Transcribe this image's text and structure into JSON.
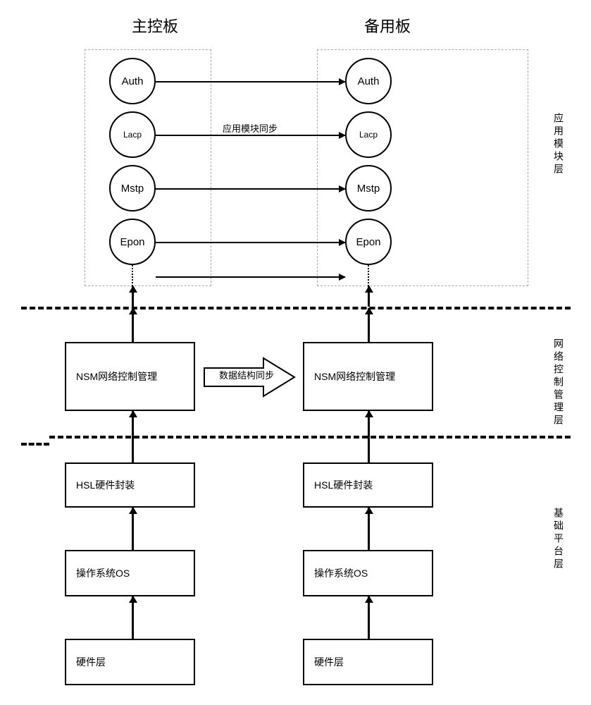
{
  "titles": {
    "master": "主控板",
    "backup": "备用板"
  },
  "layers": {
    "app": "应用模块层",
    "ncm": "网络控制管理层",
    "base": "基础平台层"
  },
  "modules": {
    "auth": "Auth",
    "lacp": "Lacp",
    "mstp": "Mstp",
    "epon": "Epon"
  },
  "boxes": {
    "nsm": "NSM网络控制管理",
    "hsl": "HSL硬件封装",
    "os": "操作系统OS",
    "hw": "硬件层"
  },
  "sync": {
    "app_module": "应用模块同步",
    "data_struct": "数据结构同步"
  }
}
